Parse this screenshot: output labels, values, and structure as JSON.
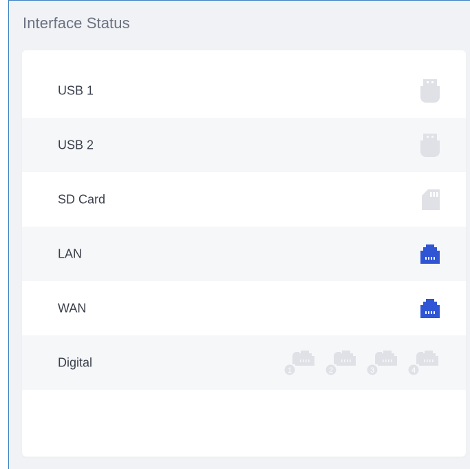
{
  "panel": {
    "title": "Interface Status"
  },
  "interfaces": [
    {
      "label": "USB 1",
      "icon": "usb-icon",
      "status": "inactive"
    },
    {
      "label": "USB 2",
      "icon": "usb-icon",
      "status": "inactive"
    },
    {
      "label": "SD Card",
      "icon": "sd-card-icon",
      "status": "inactive"
    },
    {
      "label": "LAN",
      "icon": "ethernet-port-icon",
      "status": "active"
    },
    {
      "label": "WAN",
      "icon": "ethernet-port-icon",
      "status": "active"
    },
    {
      "label": "Digital",
      "icon": "digital-port-icon",
      "status": "inactive",
      "ports": [
        "1",
        "2",
        "3",
        "4"
      ]
    }
  ],
  "colors": {
    "active": "#2f55d4",
    "inactive": "#dfe1e6",
    "title": "#6a7180",
    "text": "#3a3f4b",
    "frame_border": "#3b82c4"
  }
}
